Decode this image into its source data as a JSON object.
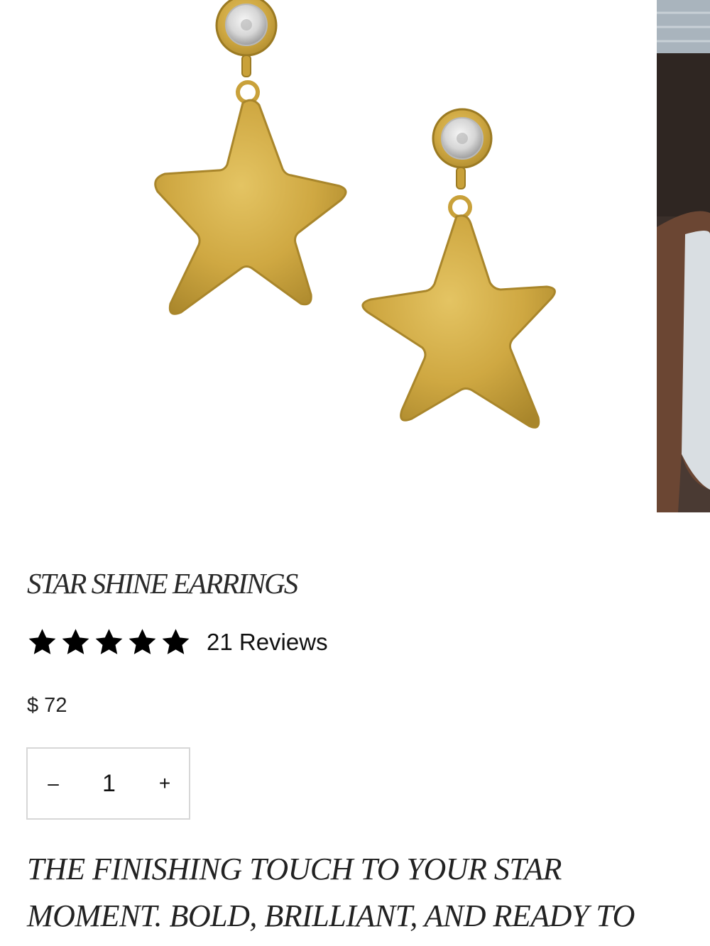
{
  "gallery": {
    "main_image_alt": "",
    "colors": {
      "gold": "#c9a13a",
      "gold_dark": "#9b7a22",
      "gold_light": "#e2c260",
      "crystal": "#dcdcdc"
    }
  },
  "product": {
    "title": "STAR SHINE EARRINGS",
    "rating_stars": 5,
    "reviews": "21 Reviews",
    "price": "$ 72",
    "quantity": {
      "decrement_label": "–",
      "value": "1",
      "increment_label": "+"
    },
    "description": "THE FINISHING TOUCH TO YOUR STAR MOMENT. BOLD, BRILLIANT, AND READY TO"
  }
}
